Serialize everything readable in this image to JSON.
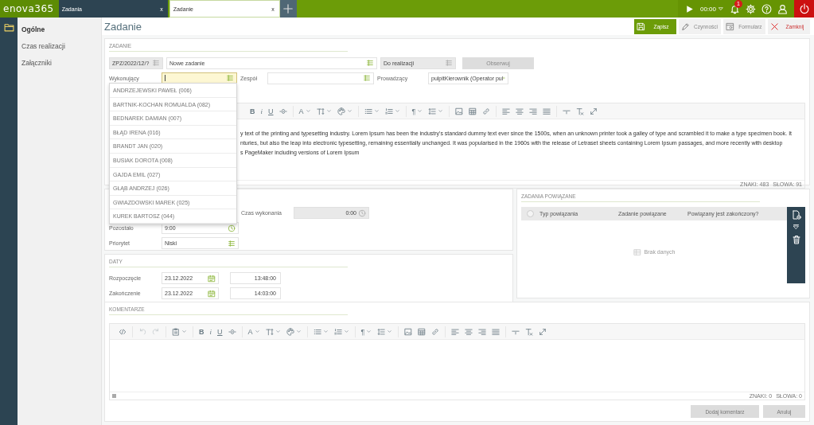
{
  "topbar": {
    "logo": "enova365",
    "tabs": [
      {
        "label": "Zadania",
        "close": "x",
        "selected": false
      },
      {
        "label": "Zadanie",
        "close": "x",
        "selected": true
      }
    ],
    "timer": "00:00",
    "notifications": "1"
  },
  "sidebar": {
    "items": [
      {
        "label": "Ogólne",
        "selected": true
      },
      {
        "label": "Czas realizacji",
        "selected": false
      },
      {
        "label": "Załączniki",
        "selected": false
      }
    ]
  },
  "page": {
    "title": "Zadanie",
    "actions": [
      {
        "label": "Zapisz",
        "kind": "save"
      },
      {
        "label": "Czynności",
        "kind": "tools"
      },
      {
        "label": "Formularz",
        "kind": "form"
      },
      {
        "label": "Zamknij",
        "kind": "close"
      }
    ]
  },
  "task": {
    "heading": "ZADANIE",
    "number": {
      "value": "ZPZ/2022/12/?",
      "disabled": true
    },
    "name": {
      "value": "Nowe zadanie",
      "disabled": false
    },
    "status": {
      "value": "Do realizacji",
      "disabled": true
    },
    "watch_button": "Obserwuj",
    "assignee": {
      "label": "Wykonujący",
      "focused": true
    },
    "team": {
      "label": "Zespół"
    },
    "lead": {
      "label": "Prowadzący",
      "value": "pulpitKierownik (Operator pul"
    },
    "assignee_options": [
      "ANDRZEJEWSKI PAWEŁ (006)",
      "BARTNIK-KOCHAN ROMUALDA (082)",
      "BEDNAREK DAMIAN (007)",
      "BŁĄD IRENA (016)",
      "BRANDT JAN (020)",
      "BUSIAK DOROTA (008)",
      "GAJDA EMIL (027)",
      "GŁĄB ANDRZEJ (026)",
      "GWIAZDOWSKI MAREK (025)",
      "KUREK BARTOSZ (044)"
    ],
    "description": {
      "toolbar": [
        [
          {
            "kind": "bold",
            "label": "B"
          },
          {
            "kind": "italic",
            "label": "i"
          },
          {
            "kind": "underline",
            "label": "U"
          },
          {
            "kind": "strike"
          }
        ],
        [
          {
            "kind": "fontcolor",
            "label": "A",
            "dropdown": true
          },
          {
            "kind": "size",
            "dropdown": true
          },
          {
            "kind": "palette",
            "dropdown": true
          }
        ],
        [
          {
            "kind": "ulist",
            "dropdown": true
          },
          {
            "kind": "olist",
            "dropdown": true
          }
        ],
        [
          {
            "kind": "paragraph",
            "label": "¶",
            "dropdown": true
          },
          {
            "kind": "lineheight",
            "dropdown": true
          }
        ],
        [
          {
            "kind": "image"
          },
          {
            "kind": "table"
          },
          {
            "kind": "link"
          }
        ],
        [
          {
            "kind": "alignleft"
          },
          {
            "kind": "aligncenter"
          },
          {
            "kind": "alignright"
          },
          {
            "kind": "justify"
          }
        ],
        [
          {
            "kind": "hr"
          },
          {
            "kind": "clear"
          },
          {
            "kind": "fullscreen"
          }
        ]
      ],
      "lines": [
        "y text of the printing and typesetting industry. Lorem Ipsum has been the industry's standard dummy text ever since the 1500s, when an unknown printer took a galley of type and scrambled it to make a type specimen book. It",
        "nturies, but also the leap into electronic typesetting, remaining essentially unchanged. It was popularised in the 1960s with the release of Letraset sheets containing Lorem Ipsum passages, and more recently with desktop",
        "s PageMaker including versions of Lorem Ipsum"
      ],
      "counters": [
        "ZNAKI: 483",
        "SŁOWA: 91"
      ]
    }
  },
  "time": {
    "work_time": {
      "label": "Czas wykonania",
      "value": "0:00"
    },
    "remaining": {
      "label": "Pozostało",
      "value": "9:00"
    },
    "priority": {
      "label": "Priorytet",
      "value": "Niski"
    }
  },
  "dates": {
    "heading": "DATY",
    "rows": [
      {
        "label": "Rozpoczęcie",
        "date": "23.12.2022",
        "time": "13:48:00"
      },
      {
        "label": "Zakończenie",
        "date": "23.12.2022",
        "time": "14:03:00"
      }
    ]
  },
  "related": {
    "heading": "ZADANIA POWIĄZANE",
    "all_selected": false,
    "columns": [
      "Typ powiązania",
      "Zadanie powiązane",
      "Powiązany jest zakończony?"
    ],
    "empty": "Brak danych"
  },
  "comments": {
    "heading": "KOMENTARZE",
    "toolbar": [
      [
        {
          "kind": "code"
        }
      ],
      [
        {
          "kind": "undo",
          "disabled": true
        },
        {
          "kind": "redo",
          "disabled": true
        }
      ],
      [
        {
          "kind": "paste",
          "dropdown": true
        }
      ],
      [
        {
          "kind": "bold",
          "label": "B"
        },
        {
          "kind": "italic",
          "label": "i"
        },
        {
          "kind": "underline",
          "label": "U"
        },
        {
          "kind": "strike"
        }
      ],
      [
        {
          "kind": "fontcolor",
          "label": "A",
          "dropdown": true
        },
        {
          "kind": "size",
          "dropdown": true
        },
        {
          "kind": "palette",
          "dropdown": true
        }
      ],
      [
        {
          "kind": "ulist",
          "dropdown": true
        },
        {
          "kind": "olist",
          "dropdown": true
        }
      ],
      [
        {
          "kind": "paragraph",
          "label": "¶",
          "dropdown": true
        },
        {
          "kind": "lineheight",
          "dropdown": true
        }
      ],
      [
        {
          "kind": "image"
        },
        {
          "kind": "table"
        },
        {
          "kind": "link"
        }
      ],
      [
        {
          "kind": "alignleft"
        },
        {
          "kind": "aligncenter"
        },
        {
          "kind": "alignright"
        },
        {
          "kind": "justify"
        }
      ],
      [
        {
          "kind": "hr"
        },
        {
          "kind": "clear"
        },
        {
          "kind": "fullscreen"
        }
      ]
    ],
    "counters": [
      "ZNAKI: 0",
      "SŁOWA: 0"
    ],
    "buttons": [
      "Dodaj komentarz",
      "Anuluj"
    ]
  }
}
